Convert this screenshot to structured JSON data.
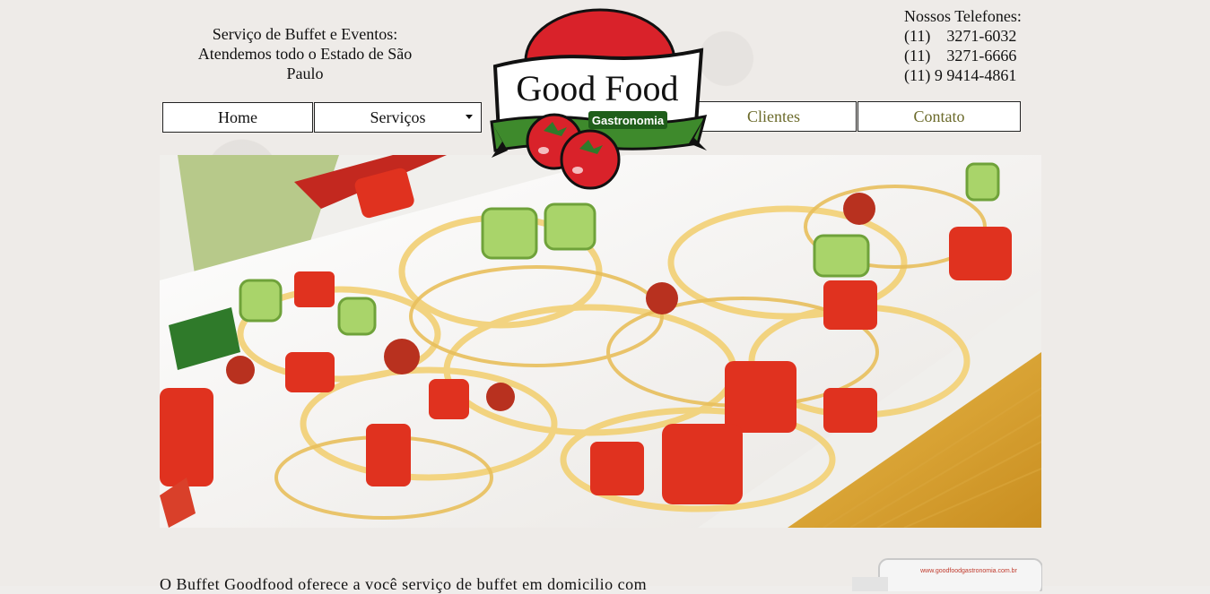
{
  "header": {
    "tagline": [
      "Serviço de Buffet e Eventos:",
      "Atendemos todo o Estado de São",
      "Paulo"
    ],
    "phones_title": "Nossos Telefones:",
    "phones": [
      "(11)    3271-6032",
      "(11)    3271-6666",
      "(11) 9 9414-4861"
    ]
  },
  "logo": {
    "brand": "Good Food",
    "sub": "Gastronomia"
  },
  "nav": {
    "home": "Home",
    "servicos": "Serviços",
    "clientes": "Clientes",
    "contato": "Contato"
  },
  "content": {
    "intro": "O Buffet Goodfood oferece a você serviço de buffet em domicilio com",
    "promo_url": "www.goodfoodgastronomia.com.br"
  },
  "colors": {
    "logo_red": "#d9222a",
    "logo_green": "#3e8a2c",
    "nav_olive": "#6b6a2a"
  }
}
